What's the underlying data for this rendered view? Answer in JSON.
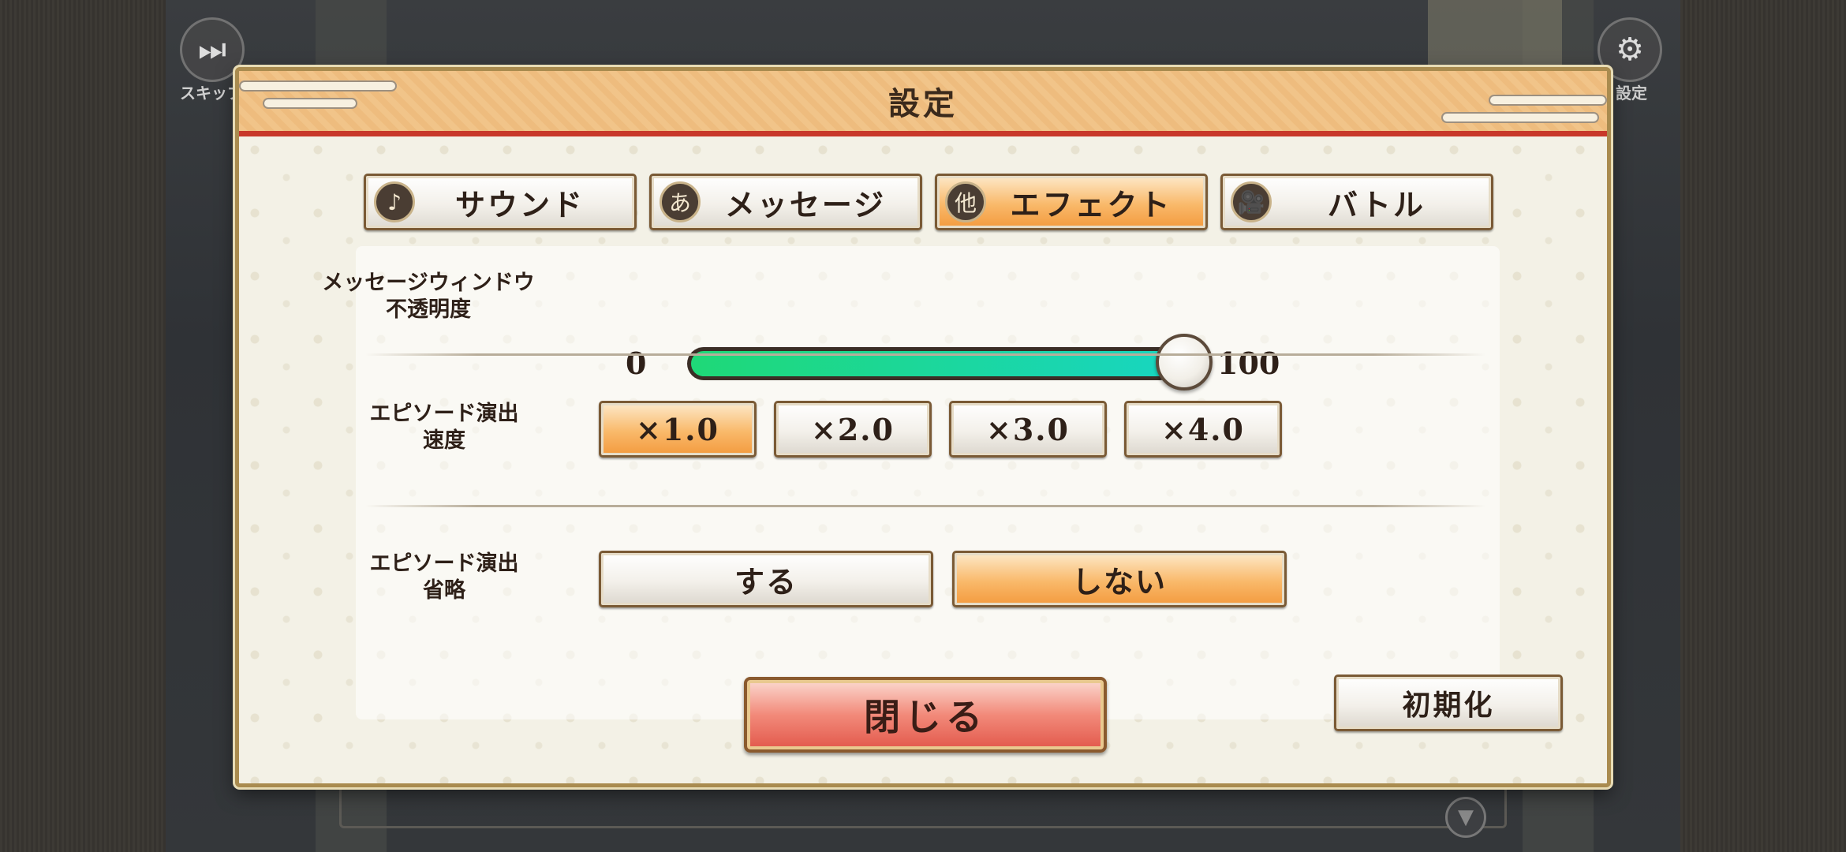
{
  "top_bar": {
    "skip_label": "スキップ",
    "settings_label": "設定"
  },
  "dialog": {
    "title": "設定",
    "tabs": [
      {
        "icon_glyph": "♪",
        "icon_name": "music-note-icon",
        "label": "サウンド",
        "active": false
      },
      {
        "icon_glyph": "あ",
        "icon_name": "hiragana-a-icon",
        "label": "メッセージ",
        "active": false
      },
      {
        "icon_glyph": "他",
        "icon_name": "other-kanji-icon",
        "label": "エフェクト",
        "active": true
      },
      {
        "icon_glyph": "🎥",
        "icon_name": "camera-icon",
        "label": "バトル",
        "active": false
      }
    ],
    "message_opacity": {
      "label_line1": "メッセージウィンドウ",
      "label_line2": "不透明度",
      "min": "0",
      "max": "100",
      "value": 100
    },
    "episode_speed": {
      "label_line1": "エピソード演出",
      "label_line2": "速度",
      "options": [
        "×1.0",
        "×2.0",
        "×3.0",
        "×4.0"
      ],
      "selected": "×1.0"
    },
    "episode_skip": {
      "label_line1": "エピソード演出",
      "label_line2": "省略",
      "options": [
        "する",
        "しない"
      ],
      "selected": "しない"
    },
    "close_label": "閉じる",
    "reset_label": "初期化"
  }
}
